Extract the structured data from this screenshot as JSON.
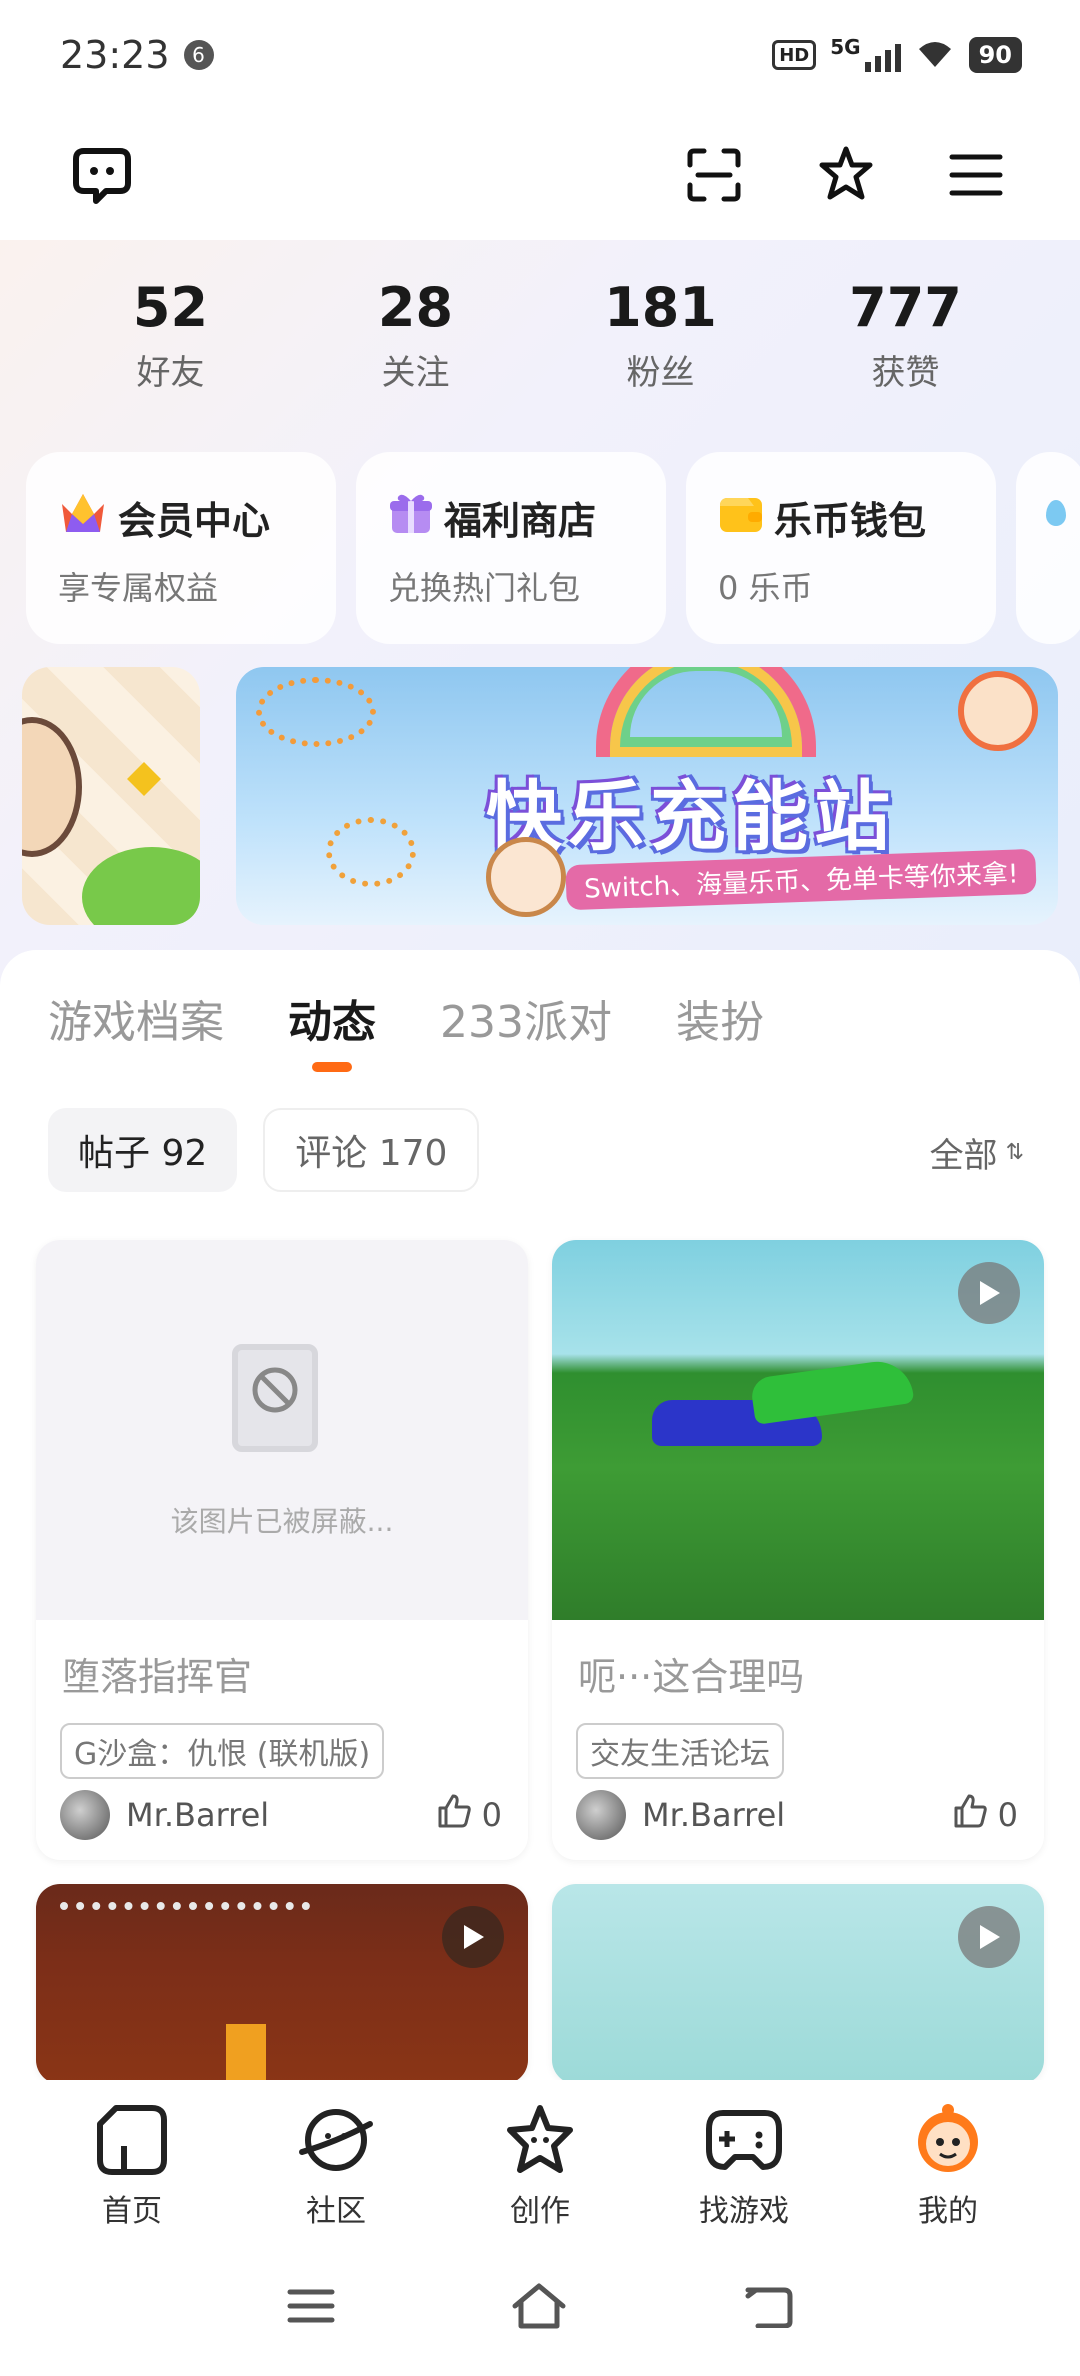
{
  "status_bar": {
    "time": "23:23",
    "notification_count": "6",
    "hd_label": "HD",
    "network": "5G",
    "battery": "90"
  },
  "stats": [
    {
      "value": "52",
      "label": "好友"
    },
    {
      "value": "28",
      "label": "关注"
    },
    {
      "value": "181",
      "label": "粉丝"
    },
    {
      "value": "777",
      "label": "获赞"
    }
  ],
  "cards": [
    {
      "title": "会员中心",
      "subtitle": "享专属权益",
      "icon": "crown-icon"
    },
    {
      "title": "福利商店",
      "subtitle": "兑换热门礼包",
      "icon": "gift-icon"
    },
    {
      "title": "乐币钱包",
      "subtitle": "0 乐币",
      "icon": "wallet-icon"
    }
  ],
  "banner": {
    "title": "快乐充能站",
    "subtitle": "Switch、海量乐币、免单卡等你来拿!"
  },
  "tabs": [
    {
      "label": "游戏档案"
    },
    {
      "label": "动态"
    },
    {
      "label": "233派对"
    },
    {
      "label": "装扮"
    }
  ],
  "active_tab": "动态",
  "filters": {
    "posts": "帖子 92",
    "comments": "评论 170",
    "sort": "全部",
    "sort_icon": "⇅"
  },
  "posts": [
    {
      "blocked_text": "该图片已被屏蔽...",
      "title": "堕落指挥官",
      "tag": "G沙盒：仇恨 (联机版)",
      "author": "Mr.Barrel",
      "likes": "0"
    },
    {
      "title": "呃···这合理吗",
      "tag": "交友生活论坛",
      "author": "Mr.Barrel",
      "likes": "0",
      "video": true
    }
  ],
  "bottom_nav": [
    {
      "label": "首页",
      "icon": "home-icon"
    },
    {
      "label": "社区",
      "icon": "community-planet-icon"
    },
    {
      "label": "创作",
      "icon": "create-star-icon"
    },
    {
      "label": "找游戏",
      "icon": "gamepad-icon"
    },
    {
      "label": "我的",
      "icon": "profile-face-icon"
    }
  ],
  "colors": {
    "accent": "#ff6a14",
    "active_nav": "#ff7a1a"
  }
}
